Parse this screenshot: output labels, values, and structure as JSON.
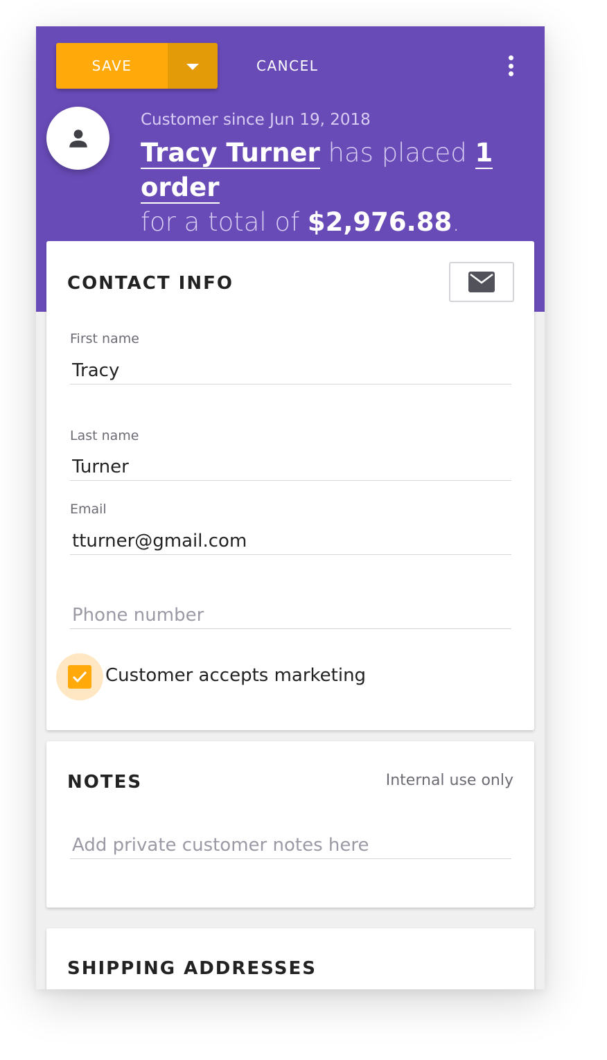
{
  "toolbar": {
    "save_label": "SAVE",
    "cancel_label": "CANCEL"
  },
  "customer": {
    "since": "Customer since Jun 19, 2018",
    "name": "Tracy Turner",
    "placed_text": "has placed",
    "orders": "1 order",
    "total_prefix": "for a total of",
    "total": "$2,976.88",
    "total_suffix": "."
  },
  "contact": {
    "title": "CONTACT INFO",
    "first_name": {
      "label": "First name",
      "value": "Tracy"
    },
    "last_name": {
      "label": "Last name",
      "value": "Turner"
    },
    "email": {
      "label": "Email",
      "value": "tturner@gmail.com"
    },
    "phone": {
      "placeholder": "Phone number",
      "value": ""
    },
    "marketing": {
      "label": "Customer accepts marketing",
      "checked": true
    }
  },
  "notes": {
    "title": "NOTES",
    "hint": "Internal use only",
    "placeholder": "Add private customer notes here"
  },
  "shipping": {
    "title": "SHIPPING ADDRESSES"
  },
  "colors": {
    "header": "#694bb8",
    "accent": "#ffa90a",
    "accent_dark": "#e49b08"
  },
  "icons": {
    "avatar": "person-icon",
    "mail": "mail-icon",
    "menu": "more-vertical-icon",
    "dropdown": "caret-down-icon",
    "check": "check-icon"
  }
}
